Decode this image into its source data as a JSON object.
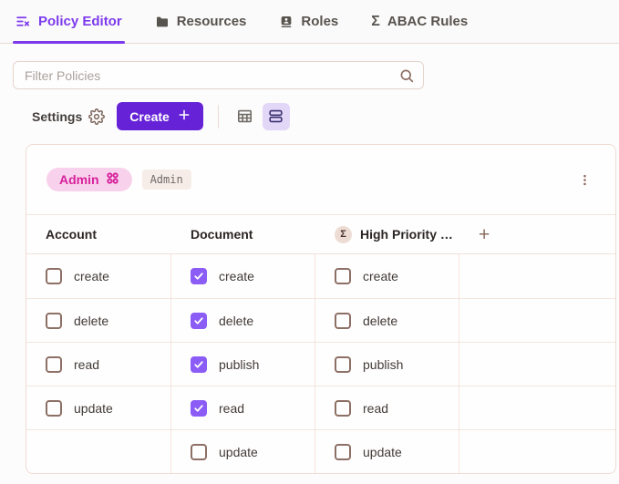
{
  "tabs": [
    {
      "label": "Policy Editor",
      "active": true
    },
    {
      "label": "Resources",
      "active": false
    },
    {
      "label": "Roles",
      "active": false
    },
    {
      "label": "ABAC Rules",
      "active": false
    }
  ],
  "filter": {
    "placeholder": "Filter Policies"
  },
  "toolbar": {
    "settings_label": "Settings",
    "create_label": "Create"
  },
  "policy_card": {
    "policy_name": "Admin",
    "role_tag": "Admin"
  },
  "table": {
    "columns": [
      {
        "label": "Account",
        "icon": null
      },
      {
        "label": "Document",
        "icon": null
      },
      {
        "label": "High Priority …",
        "icon": "sigma"
      }
    ],
    "add_column_label": "+",
    "rows": [
      [
        {
          "label": "create",
          "checked": false
        },
        {
          "label": "create",
          "checked": true
        },
        {
          "label": "create",
          "checked": false
        }
      ],
      [
        {
          "label": "delete",
          "checked": false
        },
        {
          "label": "delete",
          "checked": true
        },
        {
          "label": "delete",
          "checked": false
        }
      ],
      [
        {
          "label": "read",
          "checked": false
        },
        {
          "label": "publish",
          "checked": true
        },
        {
          "label": "publish",
          "checked": false
        }
      ],
      [
        {
          "label": "update",
          "checked": false
        },
        {
          "label": "read",
          "checked": true
        },
        {
          "label": "read",
          "checked": false
        }
      ],
      [
        null,
        {
          "label": "update",
          "checked": false
        },
        {
          "label": "update",
          "checked": false
        }
      ]
    ]
  },
  "colors": {
    "accent_purple": "#7c3aed",
    "create_button": "#6522d6",
    "checkbox_checked": "#8b5cf6",
    "pill_pink_bg": "#f8d2ec",
    "pill_pink_text": "#d6219c",
    "brown_icon": "#8b6f62"
  },
  "sigma_glyph": "Σ"
}
